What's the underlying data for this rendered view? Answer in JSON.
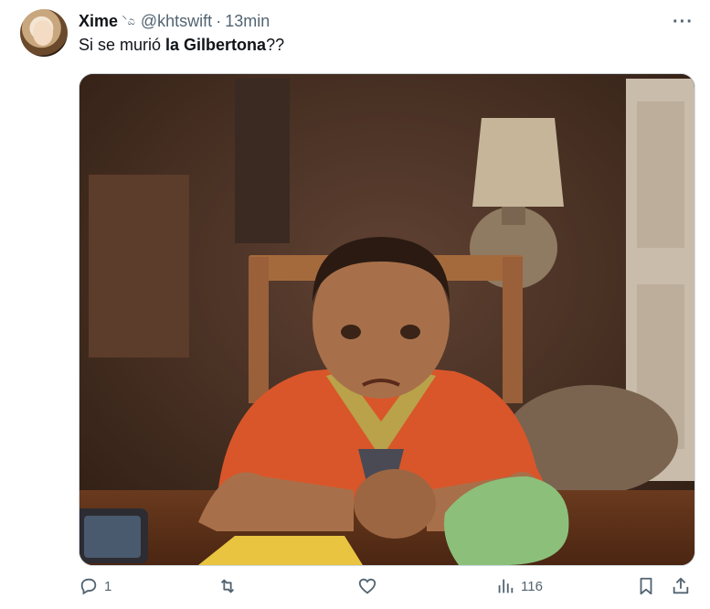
{
  "tweet": {
    "display_name": "Xime",
    "name_emoji": "⸌ಎ",
    "handle": "@khtswift",
    "separator": "·",
    "time": "13min",
    "text_part1": "Si se murió ",
    "text_bold": "la Gilbertona",
    "text_part2": "??",
    "more_label": "···",
    "media_icon": "photo-crying-child"
  },
  "actions": {
    "reply_icon": "reply-icon",
    "reply_count": "1",
    "retweet_icon": "retweet-icon",
    "retweet_count": "",
    "like_icon": "heart-icon",
    "like_count": "",
    "views_icon": "views-icon",
    "views_count": "116",
    "bookmark_icon": "bookmark-icon",
    "share_icon": "share-icon"
  },
  "colors": {
    "text_primary": "#0f1419",
    "text_secondary": "#536471",
    "border": "#cfd9de"
  }
}
